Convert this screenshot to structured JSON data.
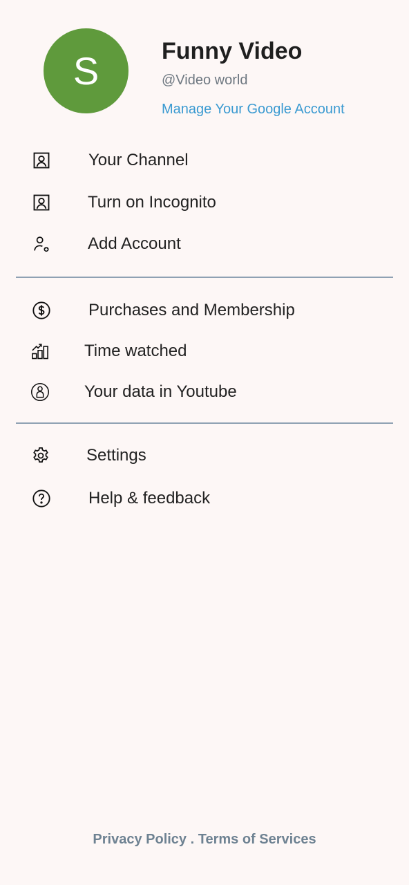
{
  "profile": {
    "avatar_letter": "S",
    "avatar_color": "#5f9a3c",
    "name": "Funny Video",
    "handle": "@Video world",
    "manage_link": "Manage Your Google Account",
    "link_color": "#3a9ad1"
  },
  "menu_section_1": [
    {
      "label": "Your Channel",
      "icon": "person-box-icon"
    },
    {
      "label": "Turn on Incognito",
      "icon": "person-box-icon"
    },
    {
      "label": "Add Account",
      "icon": "add-person-icon"
    }
  ],
  "menu_section_2": [
    {
      "label": "Purchases and Membership",
      "icon": "dollar-circle-icon"
    },
    {
      "label": "Time watched",
      "icon": "bar-chart-icon"
    },
    {
      "label": "Your data in Youtube",
      "icon": "person-circle-icon"
    }
  ],
  "menu_section_3": [
    {
      "label": "Settings",
      "icon": "gear-icon"
    },
    {
      "label": "Help & feedback",
      "icon": "help-circle-icon"
    }
  ],
  "footer": {
    "privacy": "Privacy Policy",
    "separator": " . ",
    "terms": "Terms of Services"
  }
}
